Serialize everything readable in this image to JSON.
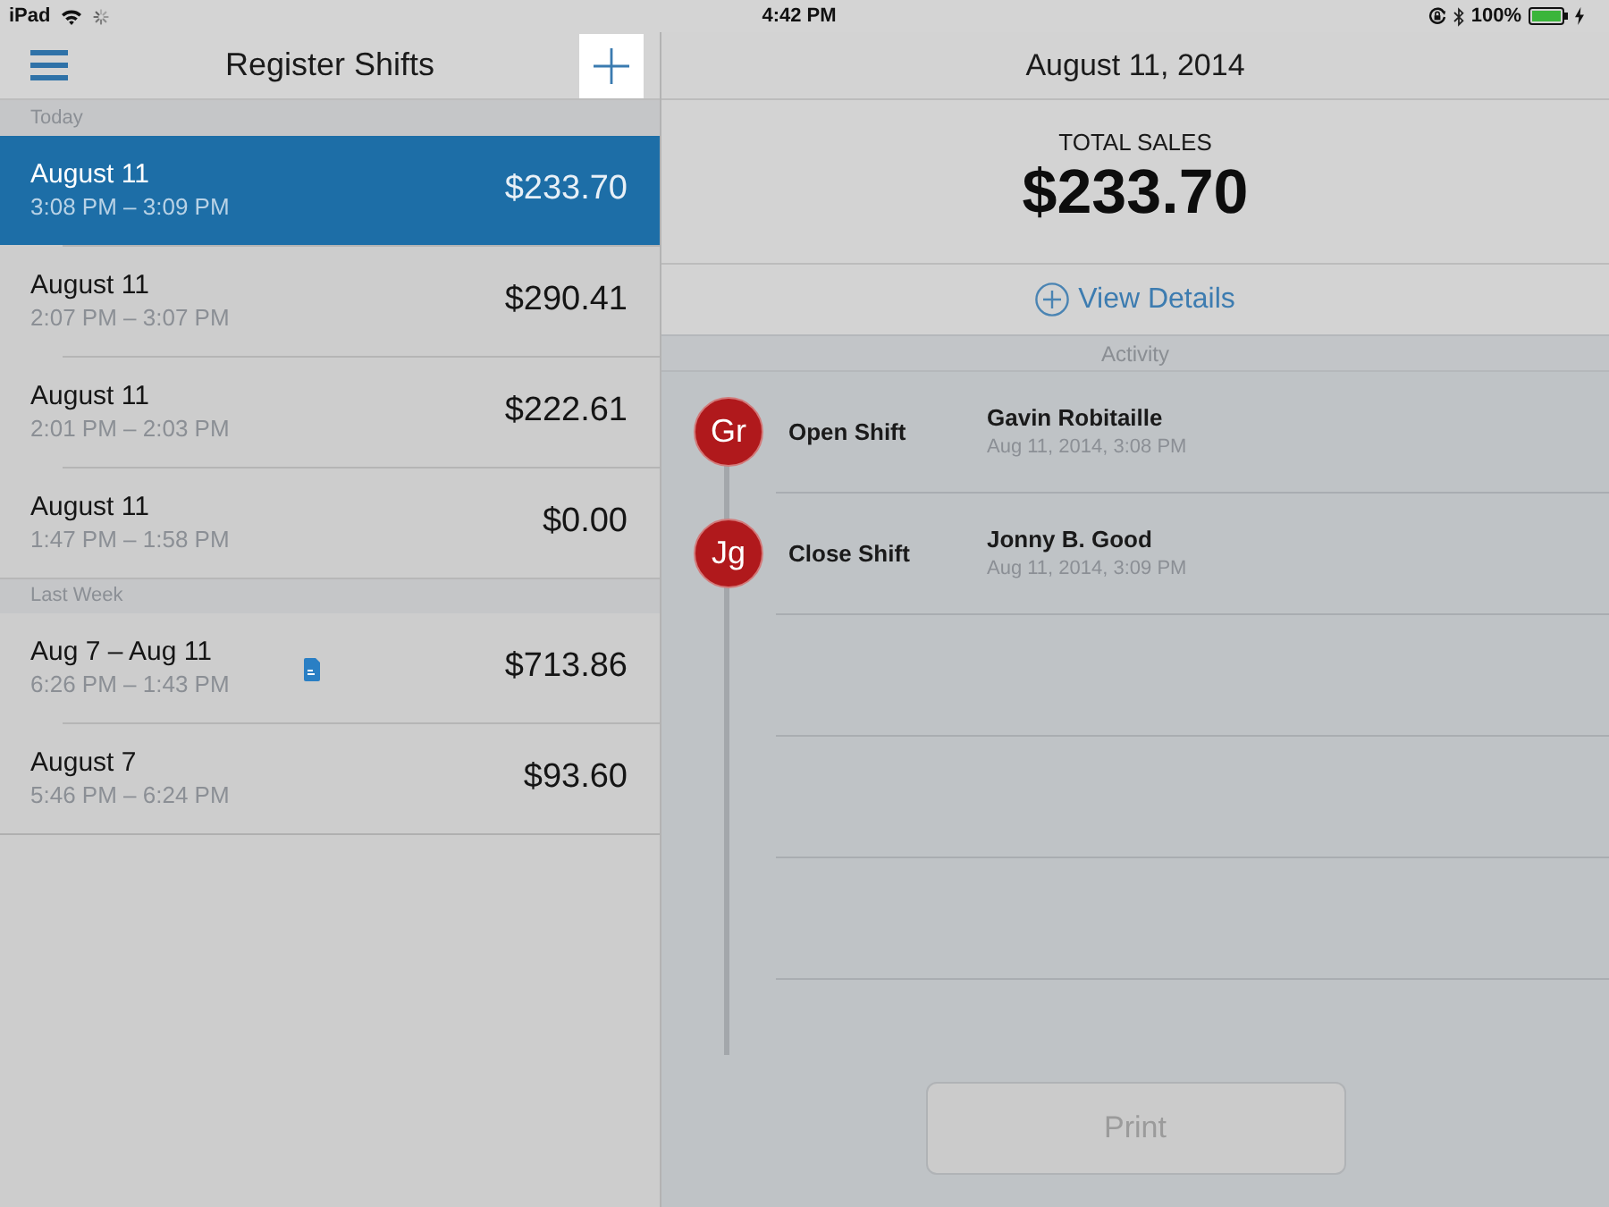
{
  "status_bar": {
    "device": "iPad",
    "time": "4:42 PM",
    "battery": "100%"
  },
  "shifts_panel": {
    "title": "Register Shifts",
    "sections": [
      {
        "label": "Today",
        "shifts": [
          {
            "date": "August 11",
            "time_range": "3:08 PM – 3:09 PM",
            "total": "$233.70",
            "selected": true,
            "has_document": false
          },
          {
            "date": "August 11",
            "time_range": "2:07 PM – 3:07 PM",
            "total": "$290.41",
            "selected": false,
            "has_document": false
          },
          {
            "date": "August 11",
            "time_range": "2:01 PM – 2:03 PM",
            "total": "$222.61",
            "selected": false,
            "has_document": false
          },
          {
            "date": "August 11",
            "time_range": "1:47 PM – 1:58 PM",
            "total": "$0.00",
            "selected": false,
            "has_document": false
          }
        ]
      },
      {
        "label": "Last Week",
        "shifts": [
          {
            "date": "Aug 7 – Aug 11",
            "time_range": "6:26 PM – 1:43 PM",
            "total": "$713.86",
            "selected": false,
            "has_document": true
          },
          {
            "date": "August 7",
            "time_range": "5:46 PM – 6:24 PM",
            "total": "$93.60",
            "selected": false,
            "has_document": false
          }
        ]
      }
    ]
  },
  "detail": {
    "date": "August 11, 2014",
    "total_label": "TOTAL SALES",
    "total": "$233.70",
    "details_link": "View Details",
    "activity_label": "Activity",
    "activity": [
      {
        "initials": "Gr",
        "action": "Open Shift",
        "name": "Gavin Robitaille",
        "timestamp": "Aug 11, 2014, 3:08 PM"
      },
      {
        "initials": "Jg",
        "action": "Close Shift",
        "name": "Jonny B. Good",
        "timestamp": "Aug 11, 2014, 3:09 PM"
      }
    ],
    "print_button": {
      "label": "Print",
      "disabled": true
    }
  }
}
